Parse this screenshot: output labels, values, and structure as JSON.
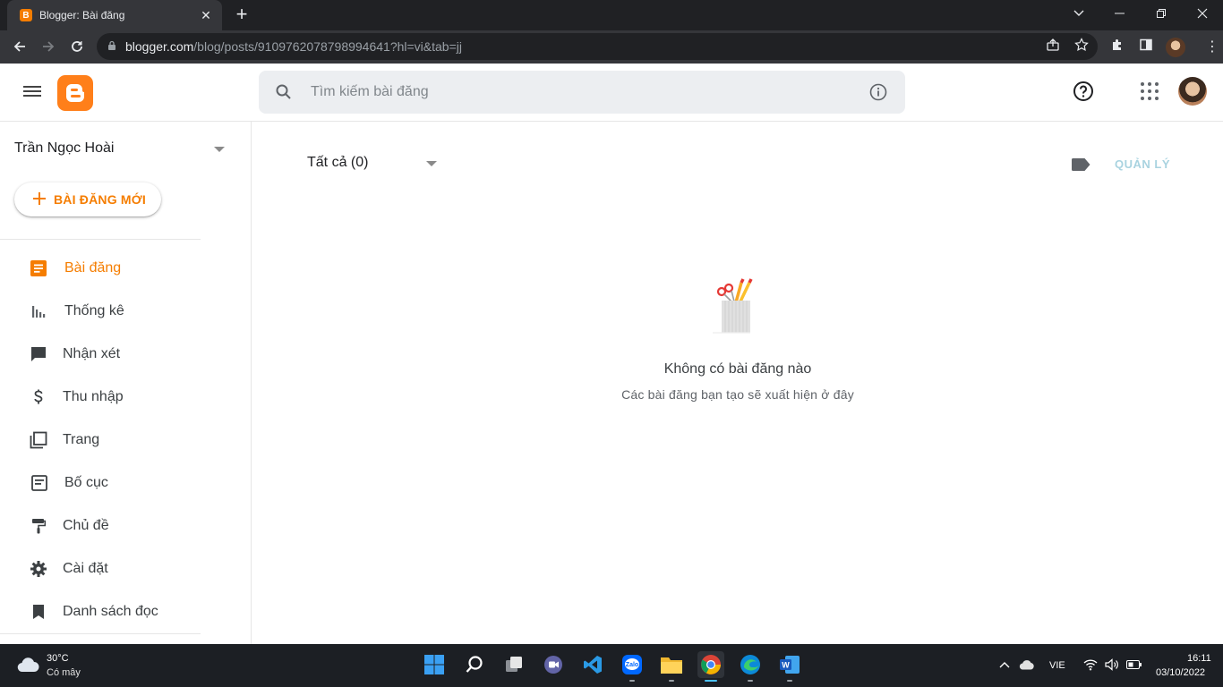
{
  "browser": {
    "tab_title": "Blogger: Bài đăng",
    "tab_favicon_letter": "B",
    "new_tab_symbol": "+",
    "url_host": "blogger.com",
    "url_path": "/blog/posts/9109762078798994641?hl=vi&tab=jj"
  },
  "header": {
    "search_placeholder": "Tìm kiếm bài đăng"
  },
  "sidebar": {
    "blog_name": "Trần Ngọc Hoài",
    "new_post_label": "BÀI ĐĂNG MỚI",
    "items": [
      {
        "label": "Bài đăng",
        "icon": "posts-icon",
        "active": true
      },
      {
        "label": "Thống kê",
        "icon": "stats-icon"
      },
      {
        "label": "Nhận xét",
        "icon": "comments-icon"
      },
      {
        "label": "Thu nhập",
        "icon": "dollar-icon"
      },
      {
        "label": "Trang",
        "icon": "pages-icon"
      },
      {
        "label": "Bố cục",
        "icon": "layout-icon"
      },
      {
        "label": "Chủ đề",
        "icon": "theme-roller-icon"
      },
      {
        "label": "Cài đặt",
        "icon": "gear-icon"
      },
      {
        "label": "Danh sách đọc",
        "icon": "bookmark-icon"
      }
    ]
  },
  "main": {
    "filter_label": "Tất cả (0)",
    "manage_label": "QUẢN LÝ",
    "empty_title": "Không có bài đăng nào",
    "empty_subtitle": "Các bài đăng bạn tạo sẽ xuất hiện ở đây"
  },
  "taskbar": {
    "weather_temp": "30°C",
    "weather_desc": "Có mây",
    "language": "VIE",
    "time": "16:11",
    "date": "03/10/2022",
    "apps": [
      "windows-start-icon",
      "search-icon",
      "task-view-icon",
      "teams-chat-icon",
      "vscode-icon",
      "zalo-icon",
      "file-explorer-icon",
      "chrome-icon",
      "edge-icon",
      "word-icon"
    ]
  },
  "colors": {
    "accent": "#f57d00",
    "manage": "#a9d3e0",
    "browser_dark": "#202124"
  }
}
